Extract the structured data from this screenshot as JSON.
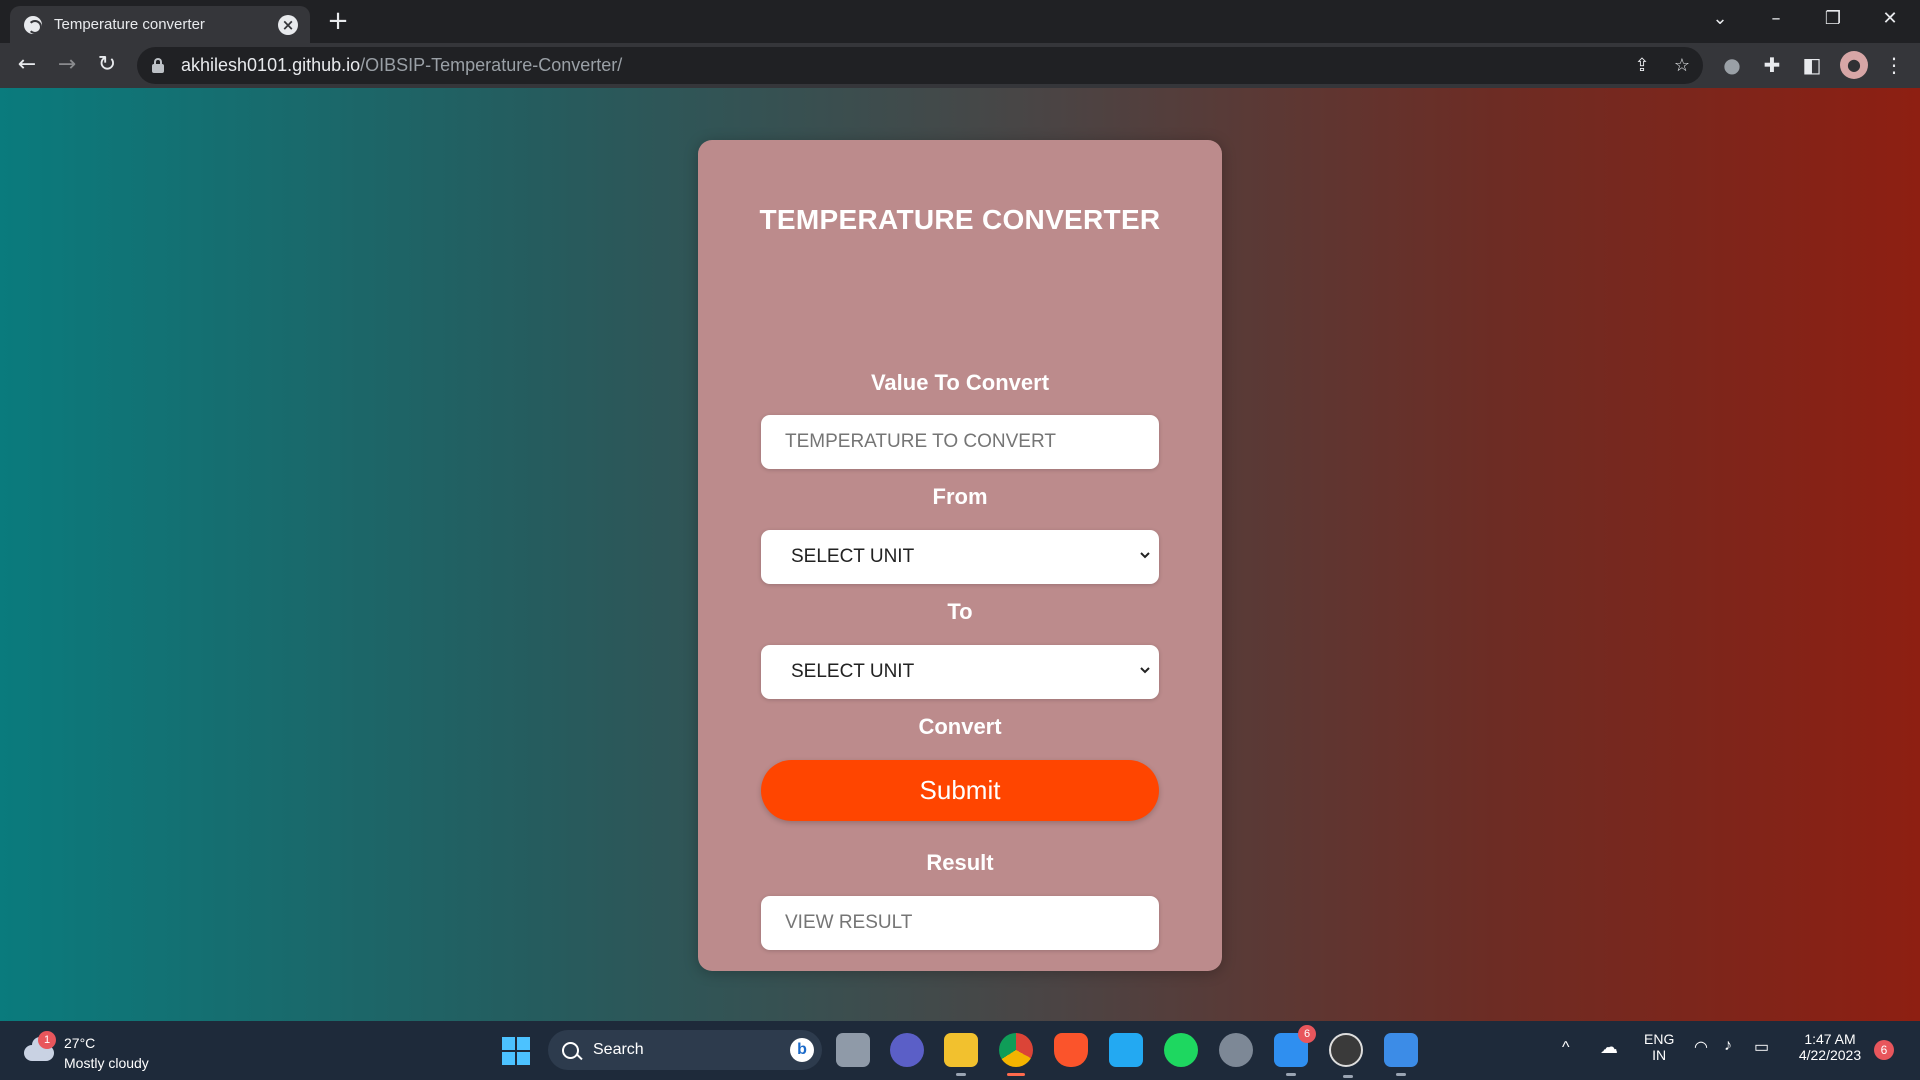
{
  "browser": {
    "tab_title": "Temperature converter",
    "url_domain": "akhilesh0101.github.io",
    "url_path": "/OIBSIP-Temperature-Converter/"
  },
  "converter": {
    "title": "TEMPERATURE CONVERTER",
    "value_label": "Value To Convert",
    "value_placeholder": "TEMPERATURE TO CONVERT",
    "from_label": "From",
    "from_selected": "SELECT UNIT",
    "to_label": "To",
    "to_selected": "SELECT UNIT",
    "convert_label": "Convert",
    "submit_label": "Submit",
    "result_label": "Result",
    "result_placeholder": "VIEW RESULT"
  },
  "taskbar": {
    "weather_badge": "1",
    "weather_temp": "27°C",
    "weather_desc": "Mostly cloudy",
    "search_label": "Search",
    "mail_badge": "6",
    "lang_line1": "ENG",
    "lang_line2": "IN",
    "time": "1:47 AM",
    "date": "4/22/2023",
    "notification_count": "6"
  },
  "colors": {
    "card_bg": "#bc8b8c",
    "submit_bg": "#ff4500",
    "gradient_left": "#0a7b7d",
    "gradient_right": "#8e1f12"
  }
}
